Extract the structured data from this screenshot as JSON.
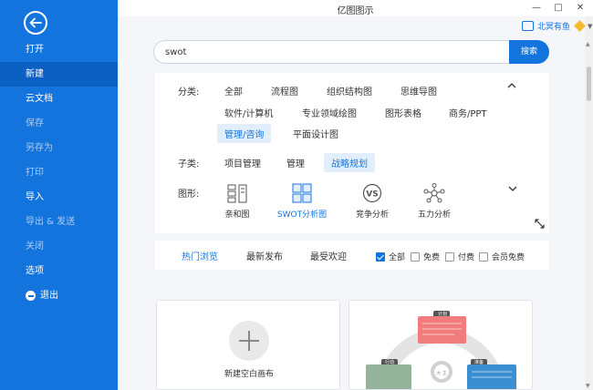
{
  "app": {
    "title": "亿图图示"
  },
  "window": {
    "minimize": "—",
    "maximize": "□",
    "close": "✕"
  },
  "sidebar": {
    "items": [
      {
        "label": "打开",
        "state": "normal"
      },
      {
        "label": "新建",
        "state": "active"
      },
      {
        "label": "云文档",
        "state": "normal"
      },
      {
        "label": "保存",
        "state": "muted"
      },
      {
        "label": "另存为",
        "state": "muted"
      },
      {
        "label": "打印",
        "state": "muted"
      },
      {
        "label": "导入",
        "state": "normal"
      },
      {
        "label": "导出 & 发送",
        "state": "muted"
      },
      {
        "label": "关闭",
        "state": "muted"
      },
      {
        "label": "选项",
        "state": "normal"
      }
    ],
    "exit_label": "退出"
  },
  "user": {
    "name": "北冥有鱼"
  },
  "search": {
    "value": "swot",
    "button_label": "搜索"
  },
  "filters": {
    "category_label": "分类:",
    "categories": [
      "全部",
      "流程图",
      "组织结构图",
      "思维导图",
      "软件/计算机",
      "专业领域绘图",
      "图形表格",
      "商务/PPT",
      "管理/咨询",
      "平面设计图"
    ],
    "selected_category": "管理/咨询",
    "subcategory_label": "子类:",
    "subcategories": [
      "项目管理",
      "管理",
      "战略规划"
    ],
    "selected_subcategory": "战略规划",
    "shape_label": "图形:",
    "shapes": [
      {
        "label": "亲和图",
        "icon": "affinity-diagram-icon"
      },
      {
        "label": "SWOT分析图",
        "icon": "swot-grid-icon"
      },
      {
        "label": "竞争分析",
        "icon": "vs-icon"
      },
      {
        "label": "五力分析",
        "icon": "five-forces-icon"
      }
    ],
    "selected_shape": "SWOT分析图"
  },
  "sort_tabs": [
    "热门浏览",
    "最新发布",
    "最受欢迎"
  ],
  "active_sort_tab": "热门浏览",
  "price_filters": [
    {
      "label": "全部",
      "checked": true
    },
    {
      "label": "免费",
      "checked": false
    },
    {
      "label": "付费",
      "checked": false
    },
    {
      "label": "会员免费",
      "checked": false
    }
  ],
  "cards": {
    "blank_label": "新建空白画布",
    "template": {
      "top_label": "计划",
      "left_label": "行动",
      "right_label": "准备",
      "center_label": "大 主"
    }
  },
  "colors": {
    "accent": "#1474dd",
    "sidebar_active": "#0c5fc3",
    "chip_bg": "#e1eefc"
  }
}
